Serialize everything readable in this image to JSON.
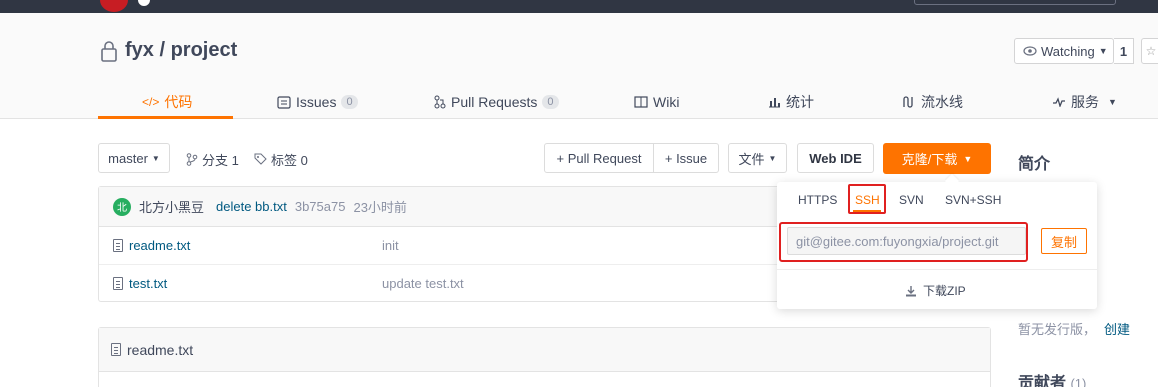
{
  "colors": {
    "accent": "#fe7300",
    "highlight": "#e02020",
    "topbar": "#303643",
    "link": "#005980"
  },
  "repo": {
    "title": "fyx / project"
  },
  "watch": {
    "label": "Watching",
    "count": "1",
    "star_icon": "star-icon"
  },
  "tabs": [
    {
      "label": "代码",
      "icon": "code-icon"
    },
    {
      "label": "Issues",
      "count": "0",
      "icon": "issues-icon"
    },
    {
      "label": "Pull Requests",
      "count": "0",
      "icon": "pull-request-icon"
    },
    {
      "label": "Wiki",
      "icon": "wiki-icon"
    },
    {
      "label": "统计",
      "icon": "stats-icon"
    },
    {
      "label": "流水线",
      "icon": "pipeline-icon"
    },
    {
      "label": "服务",
      "icon": "service-icon"
    }
  ],
  "toolbar": {
    "branch": "master",
    "branches": "分支 1",
    "tags": "标签 0",
    "pull_request": "+ Pull Request",
    "issue": "+ Issue",
    "file_menu": "文件",
    "web_ide": "Web IDE",
    "clone": "克隆/下载"
  },
  "commit": {
    "avatar_text": "北",
    "author": "北方小黑豆",
    "message": "delete bb.txt",
    "hash": "3b75a75",
    "time": "23小时前"
  },
  "files": [
    {
      "name": "readme.txt",
      "message": "init"
    },
    {
      "name": "test.txt",
      "message": "update test.txt"
    }
  ],
  "readme": {
    "title": "readme.txt"
  },
  "sidebar": {
    "intro_title": "简介",
    "release_text": "暂无发行版，",
    "create_link": "创建",
    "contributors_title": "贡献者",
    "contributors_count": "(1)"
  },
  "clone_dropdown": {
    "protocols": [
      "HTTPS",
      "SSH",
      "SVN",
      "SVN+SSH"
    ],
    "selected": "SSH",
    "url": "git@gitee.com:fuyongxia/project.git",
    "copy_label": "复制",
    "zip_label": "下载ZIP"
  }
}
